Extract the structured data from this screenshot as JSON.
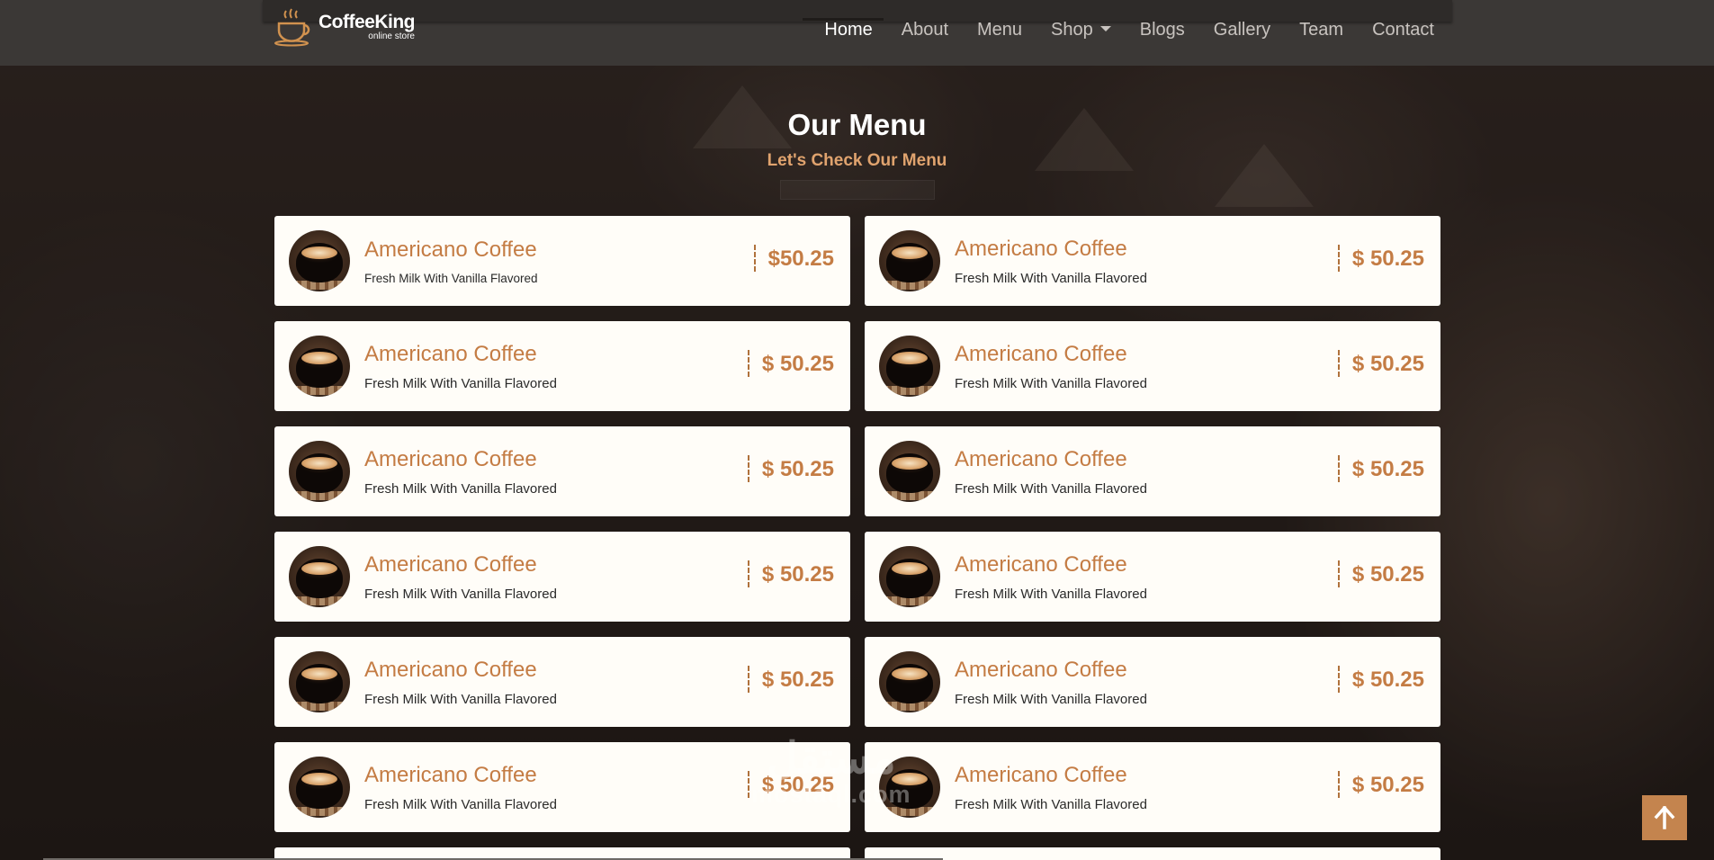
{
  "brand": {
    "name": "CoffeeKing",
    "tagline": "online store"
  },
  "nav": [
    {
      "label": "Home",
      "active": true,
      "dropdown": false
    },
    {
      "label": "About",
      "active": false,
      "dropdown": false
    },
    {
      "label": "Menu",
      "active": false,
      "dropdown": false
    },
    {
      "label": "Shop",
      "active": false,
      "dropdown": true
    },
    {
      "label": "Blogs",
      "active": false,
      "dropdown": false
    },
    {
      "label": "Gallery",
      "active": false,
      "dropdown": false
    },
    {
      "label": "Team",
      "active": false,
      "dropdown": false
    },
    {
      "label": "Contact",
      "active": false,
      "dropdown": false
    }
  ],
  "section": {
    "title": "Our Menu",
    "subtitle": "Let's Check Our Menu"
  },
  "menu_items": [
    {
      "name": "Americano Coffee",
      "desc": "Fresh Milk With Vanilla Flavored",
      "price": "$50.25"
    },
    {
      "name": "Americano Coffee",
      "desc": "Fresh Milk With Vanilla Flavored",
      "price": "$ 50.25"
    },
    {
      "name": "Americano Coffee",
      "desc": "Fresh Milk With Vanilla Flavored",
      "price": "$ 50.25"
    },
    {
      "name": "Americano Coffee",
      "desc": "Fresh Milk With Vanilla Flavored",
      "price": "$ 50.25"
    },
    {
      "name": "Americano Coffee",
      "desc": "Fresh Milk With Vanilla Flavored",
      "price": "$ 50.25"
    },
    {
      "name": "Americano Coffee",
      "desc": "Fresh Milk With Vanilla Flavored",
      "price": "$ 50.25"
    },
    {
      "name": "Americano Coffee",
      "desc": "Fresh Milk With Vanilla Flavored",
      "price": "$ 50.25"
    },
    {
      "name": "Americano Coffee",
      "desc": "Fresh Milk With Vanilla Flavored",
      "price": "$ 50.25"
    },
    {
      "name": "Americano Coffee",
      "desc": "Fresh Milk With Vanilla Flavored",
      "price": "$ 50.25"
    },
    {
      "name": "Americano Coffee",
      "desc": "Fresh Milk With Vanilla Flavored",
      "price": "$ 50.25"
    },
    {
      "name": "Americano Coffee",
      "desc": "Fresh Milk With Vanilla Flavored",
      "price": "$ 50.25"
    },
    {
      "name": "Americano Coffee",
      "desc": "Fresh Milk With Vanilla Flavored",
      "price": "$ 50.25"
    }
  ],
  "watermark": {
    "arabic": "مستقل",
    "latin": "mostaql.com"
  },
  "icons": {
    "logo": "coffee-cup-icon",
    "to_top": "arrow-up-icon",
    "menu_item": "coffee-cup-photo-icon"
  },
  "colors": {
    "accent": "#c47c44",
    "subtitle": "#e0a36e",
    "header_bg": "#3b3836",
    "card_bg": "#fffdf8",
    "to_top_bg": "#c4844e"
  }
}
